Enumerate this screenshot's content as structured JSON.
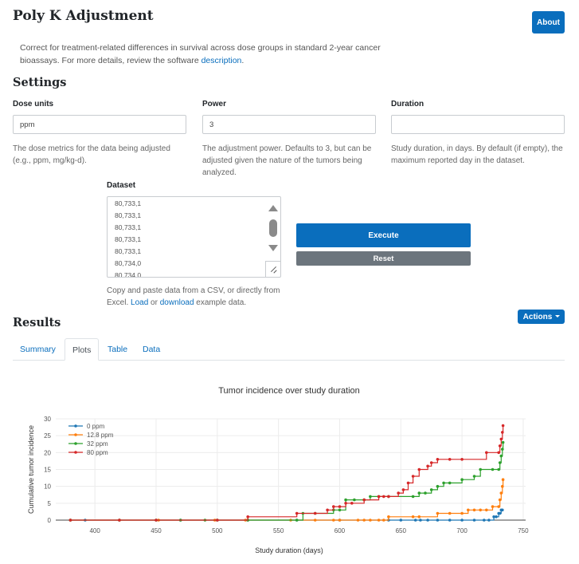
{
  "header": {
    "title": "Poly K Adjustment",
    "about_label": "About"
  },
  "intro": {
    "text": "Correct for treatment-related differences in survival across dose groups in standard 2-year cancer bioassays. For more details, review the software ",
    "link": "description",
    "end": "."
  },
  "settings": {
    "heading": "Settings",
    "dose_units": {
      "label": "Dose units",
      "value": "ppm",
      "help": "The dose metrics for the data being adjusted (e.g., ppm, mg/kg-d)."
    },
    "power": {
      "label": "Power",
      "value": "3",
      "help": "The adjustment power. Defaults to 3, but can be adjusted given the nature of the tumors being analyzed."
    },
    "duration": {
      "label": "Duration",
      "value": "",
      "help": "Study duration, in days. By default (if empty), the maximum reported day in the dataset."
    },
    "dataset": {
      "label": "Dataset",
      "lines": [
        "80,733,1",
        "80,733,1",
        "80,733,1",
        "80,733,1",
        "80,733,1",
        "80,734,0",
        "80,734,0"
      ],
      "help_pre": "Copy and paste data from a CSV, or directly from Excel. ",
      "load": "Load",
      "or": " or ",
      "download": "download",
      "help_post": " example data."
    },
    "execute_label": "Execute",
    "reset_label": "Reset"
  },
  "results": {
    "heading": "Results",
    "actions_label": "Actions",
    "tabs": [
      {
        "label": "Summary",
        "active": false
      },
      {
        "label": "Plots",
        "active": true
      },
      {
        "label": "Table",
        "active": false
      },
      {
        "label": "Data",
        "active": false
      }
    ]
  },
  "chart_data": {
    "type": "line",
    "title": "Tumor incidence over study duration",
    "xlabel": "Study duration (days)",
    "ylabel": "Cumulative tumor incidence",
    "xlim": [
      368,
      752
    ],
    "ylim": [
      0,
      30
    ],
    "xticks": [
      400,
      450,
      500,
      550,
      600,
      650,
      700,
      750
    ],
    "yticks": [
      0,
      5,
      10,
      15,
      20,
      25,
      30
    ],
    "grid": true,
    "legend_position": "top-left",
    "series": [
      {
        "name": "0 ppm",
        "color": "#1f77b4",
        "x": [
          380,
          392,
          420,
          450,
          470,
          500,
          525,
          565,
          600,
          640,
          650,
          662,
          666,
          672,
          680,
          690,
          700,
          710,
          718,
          722,
          726,
          728,
          730,
          731,
          732,
          733
        ],
        "y": [
          0,
          0,
          0,
          0,
          0,
          0,
          0,
          0,
          0,
          0,
          0,
          0,
          0,
          0,
          0,
          0,
          0,
          0,
          0,
          0,
          1,
          1,
          2,
          2,
          3,
          3
        ]
      },
      {
        "name": "12.8 ppm",
        "color": "#ff7f0e",
        "x": [
          380,
          420,
          452,
          498,
          523,
          560,
          580,
          595,
          600,
          615,
          620,
          625,
          632,
          636,
          640,
          660,
          665,
          680,
          690,
          700,
          705,
          710,
          715,
          720,
          725,
          730,
          731,
          732,
          733,
          733.5
        ],
        "y": [
          0,
          0,
          0,
          0,
          0,
          0,
          0,
          0,
          0,
          0,
          0,
          0,
          0,
          0,
          1,
          1,
          1,
          2,
          2,
          2,
          3,
          3,
          3,
          3,
          4,
          4,
          6,
          8,
          10,
          12
        ]
      },
      {
        "name": "32 ppm",
        "color": "#2ca02c",
        "x": [
          380,
          420,
          450,
          470,
          490,
          500,
          525,
          565,
          570,
          580,
          595,
          600,
          605,
          612,
          620,
          625,
          632,
          640,
          660,
          665,
          670,
          675,
          680,
          685,
          690,
          700,
          710,
          715,
          725,
          730,
          731,
          732,
          733,
          733.5
        ],
        "y": [
          0,
          0,
          0,
          0,
          0,
          0,
          0,
          0,
          2,
          2,
          3,
          3,
          6,
          6,
          6,
          7,
          7,
          7,
          7,
          8,
          8,
          9,
          10,
          11,
          11,
          12,
          13,
          15,
          15,
          15,
          17,
          19,
          21,
          23
        ]
      },
      {
        "name": "80 ppm",
        "color": "#d62728",
        "x": [
          380,
          420,
          450,
          500,
          525,
          565,
          580,
          590,
          595,
          600,
          605,
          610,
          620,
          632,
          636,
          640,
          648,
          652,
          656,
          660,
          665,
          672,
          675,
          680,
          690,
          700,
          720,
          730,
          731,
          732,
          733,
          733.5
        ],
        "y": [
          0,
          0,
          0,
          0,
          1,
          2,
          2,
          3,
          4,
          4,
          5,
          5,
          6,
          7,
          7,
          7,
          8,
          9,
          11,
          13,
          15,
          16,
          17,
          18,
          18,
          18,
          20,
          20,
          22,
          24,
          26,
          28
        ]
      }
    ]
  }
}
